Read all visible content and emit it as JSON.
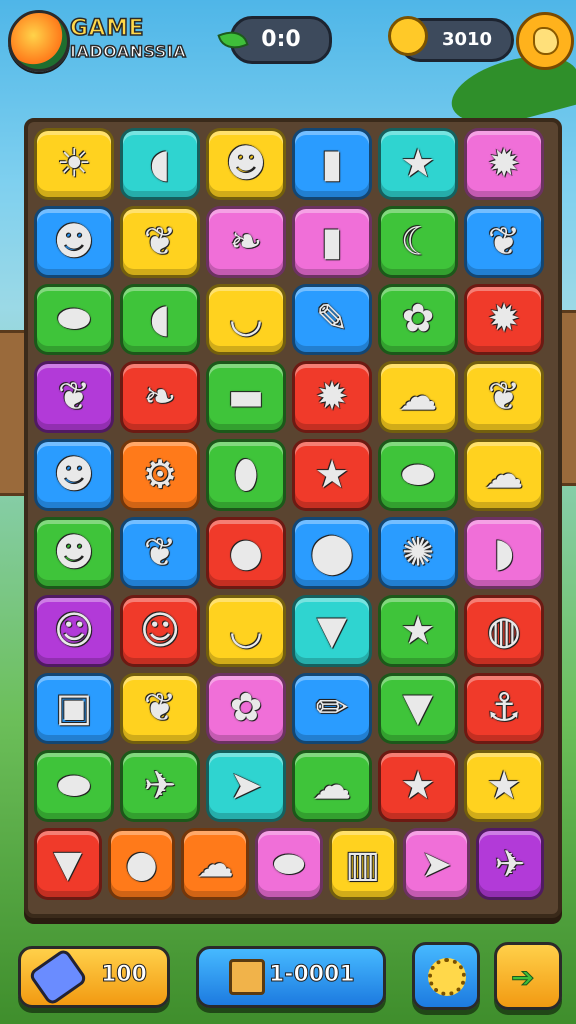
{
  "header": {
    "title_line1": "GAME",
    "title_line2": "IADOANSSIA",
    "score": "0:0",
    "coins": "3010"
  },
  "footer": {
    "hammer_count": "100",
    "moves": "1-0001"
  },
  "colors": {
    "yellow": "#ffd21f",
    "cyan": "#2fd4d0",
    "pink": "#f06fd8",
    "blue": "#2a9cff",
    "green": "#3fc43a",
    "orange": "#ff7a1a",
    "red": "#f03a2a",
    "purple": "#b23ad8",
    "lime": "#7dd82a"
  },
  "board": {
    "rows": [
      [
        {
          "c": "yellow",
          "i": "sun-wing-icon"
        },
        {
          "c": "cyan",
          "i": "fish-icon"
        },
        {
          "c": "yellow",
          "i": "creature-icon"
        },
        {
          "c": "blue",
          "i": "bottle-icon"
        },
        {
          "c": "cyan",
          "i": "star-icon"
        },
        {
          "c": "pink",
          "i": "splat-icon"
        }
      ],
      [
        {
          "c": "blue",
          "i": "monster-icon"
        },
        {
          "c": "yellow",
          "i": "leaf-icon"
        },
        {
          "c": "pink",
          "i": "feather-icon"
        },
        {
          "c": "pink",
          "i": "bottle-icon"
        },
        {
          "c": "green",
          "i": "crescent-icon"
        },
        {
          "c": "blue",
          "i": "leaf-icon"
        }
      ],
      [
        {
          "c": "green",
          "i": "egg-icon"
        },
        {
          "c": "green",
          "i": "fish-icon"
        },
        {
          "c": "yellow",
          "i": "banana-icon"
        },
        {
          "c": "blue",
          "i": "brush-icon"
        },
        {
          "c": "green",
          "i": "plant-icon"
        },
        {
          "c": "red",
          "i": "splat-icon"
        }
      ],
      [
        {
          "c": "purple",
          "i": "leaf-icon"
        },
        {
          "c": "red",
          "i": "feather-icon"
        },
        {
          "c": "green",
          "i": "pipe-icon"
        },
        {
          "c": "red",
          "i": "splat-icon"
        },
        {
          "c": "yellow",
          "i": "cloud-icon"
        },
        {
          "c": "yellow",
          "i": "leaf-icon"
        }
      ],
      [
        {
          "c": "blue",
          "i": "monster-icon"
        },
        {
          "c": "orange",
          "i": "tool-icon"
        },
        {
          "c": "green",
          "i": "pepper-icon"
        },
        {
          "c": "red",
          "i": "star-icon"
        },
        {
          "c": "green",
          "i": "egg-icon"
        },
        {
          "c": "yellow",
          "i": "cloud-icon"
        }
      ],
      [
        {
          "c": "green",
          "i": "monster-icon"
        },
        {
          "c": "blue",
          "i": "leaf-icon"
        },
        {
          "c": "red",
          "i": "orange-icon"
        },
        {
          "c": "blue",
          "i": "grape-icon"
        },
        {
          "c": "blue",
          "i": "virus-icon"
        },
        {
          "c": "pink",
          "i": "bean-icon"
        }
      ],
      [
        {
          "c": "purple",
          "i": "smile-icon"
        },
        {
          "c": "red",
          "i": "smile-icon"
        },
        {
          "c": "yellow",
          "i": "banana-icon"
        },
        {
          "c": "cyan",
          "i": "carrot-icon"
        },
        {
          "c": "green",
          "i": "star-icon"
        },
        {
          "c": "red",
          "i": "lemon-icon"
        }
      ],
      [
        {
          "c": "blue",
          "i": "cube-icon"
        },
        {
          "c": "yellow",
          "i": "leaf-icon"
        },
        {
          "c": "pink",
          "i": "plant-icon"
        },
        {
          "c": "blue",
          "i": "pencil-icon"
        },
        {
          "c": "green",
          "i": "carrot-icon"
        },
        {
          "c": "red",
          "i": "ship-icon"
        }
      ],
      [
        {
          "c": "green",
          "i": "egg-icon"
        },
        {
          "c": "green",
          "i": "bird-icon"
        },
        {
          "c": "cyan",
          "i": "arrow-icon"
        },
        {
          "c": "green",
          "i": "cloud-icon"
        },
        {
          "c": "red",
          "i": "star-icon"
        },
        {
          "c": "yellow",
          "i": "star-icon"
        }
      ],
      [
        {
          "c": "red",
          "i": "carrot-icon"
        },
        {
          "c": "orange",
          "i": "apple-icon"
        },
        {
          "c": "orange",
          "i": "cloud-icon"
        },
        {
          "c": "pink",
          "i": "egg-icon"
        },
        {
          "c": "yellow",
          "i": "fence-icon"
        },
        {
          "c": "pink",
          "i": "arrow-icon"
        },
        {
          "c": "purple",
          "i": "bird-icon"
        }
      ]
    ]
  }
}
